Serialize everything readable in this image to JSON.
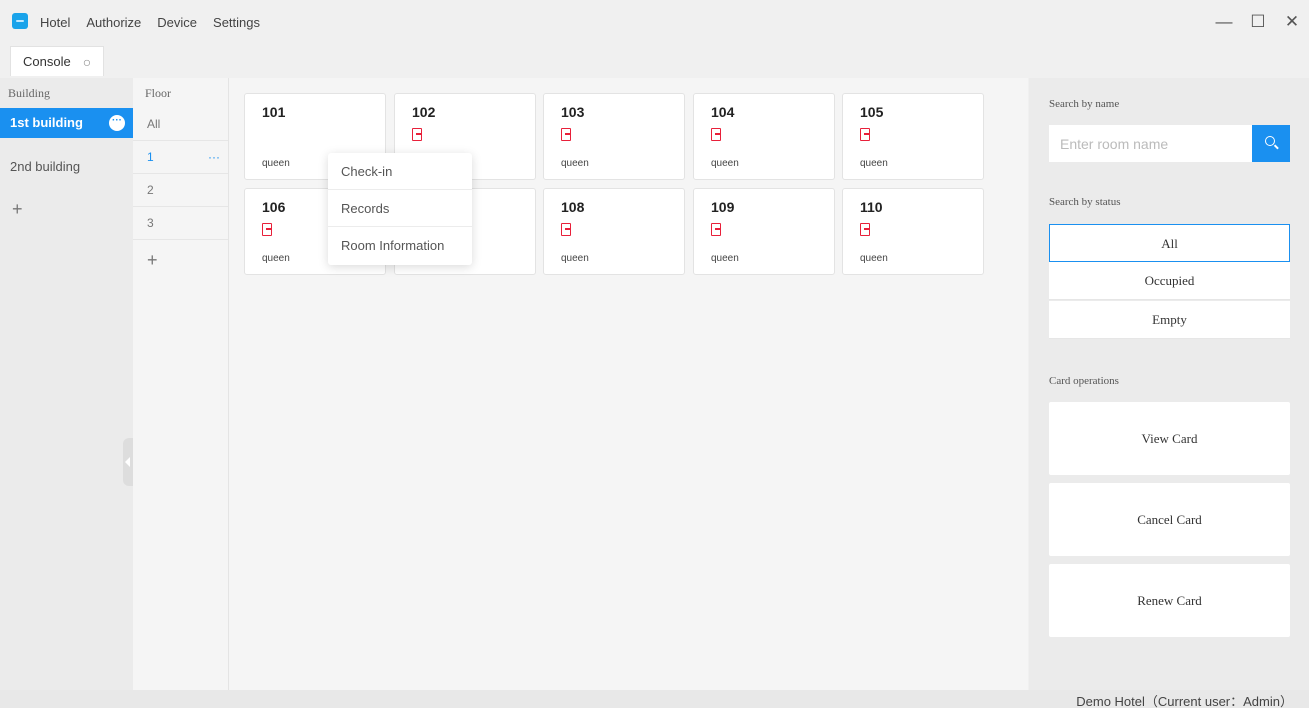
{
  "titlebar": {
    "menu": [
      "Hotel",
      "Authorize",
      "Device",
      "Settings"
    ],
    "window_controls": {
      "minimize": "—",
      "maximize": "☐",
      "close": "✕"
    }
  },
  "tabs": [
    {
      "label": "Console",
      "refresh_icon": "refresh-icon"
    }
  ],
  "building": {
    "header": "Building",
    "items": [
      {
        "label": "1st building",
        "active": true
      },
      {
        "label": "2nd building",
        "active": false
      }
    ],
    "add_label": "+"
  },
  "floor": {
    "header": "Floor",
    "items": [
      {
        "label": "All",
        "active": false
      },
      {
        "label": "1",
        "active": true,
        "more": "···"
      },
      {
        "label": "2",
        "active": false
      },
      {
        "label": "3",
        "active": false
      }
    ],
    "add_label": "+"
  },
  "rooms": [
    {
      "number": "101",
      "type": "queen",
      "status_icon": false
    },
    {
      "number": "102",
      "type": "",
      "status_icon": true
    },
    {
      "number": "103",
      "type": "queen",
      "status_icon": true
    },
    {
      "number": "104",
      "type": "queen",
      "status_icon": true
    },
    {
      "number": "105",
      "type": "queen",
      "status_icon": true
    },
    {
      "number": "106",
      "type": "queen",
      "status_icon": true
    },
    {
      "number": "",
      "type": "",
      "status_icon": false
    },
    {
      "number": "108",
      "type": "queen",
      "status_icon": true
    },
    {
      "number": "109",
      "type": "queen",
      "status_icon": true
    },
    {
      "number": "110",
      "type": "queen",
      "status_icon": true
    }
  ],
  "context_menu": {
    "items": [
      "Check-in",
      "Records",
      "Room Information"
    ]
  },
  "right_panel": {
    "search_by_name_label": "Search by name",
    "search_placeholder": "Enter room name",
    "search_by_status_label": "Search by status",
    "status_options": [
      {
        "label": "All",
        "active": true
      },
      {
        "label": "Occupied",
        "active": false
      },
      {
        "label": "Empty",
        "active": false
      }
    ],
    "card_operations_label": "Card operations",
    "card_buttons": [
      "View Card",
      "Cancel Card",
      "Renew Card"
    ]
  },
  "statusbar": {
    "text": "Demo Hotel（Current user：Admin）"
  },
  "colors": {
    "accent": "#1a90f0",
    "room_icon": "#e8203a"
  }
}
